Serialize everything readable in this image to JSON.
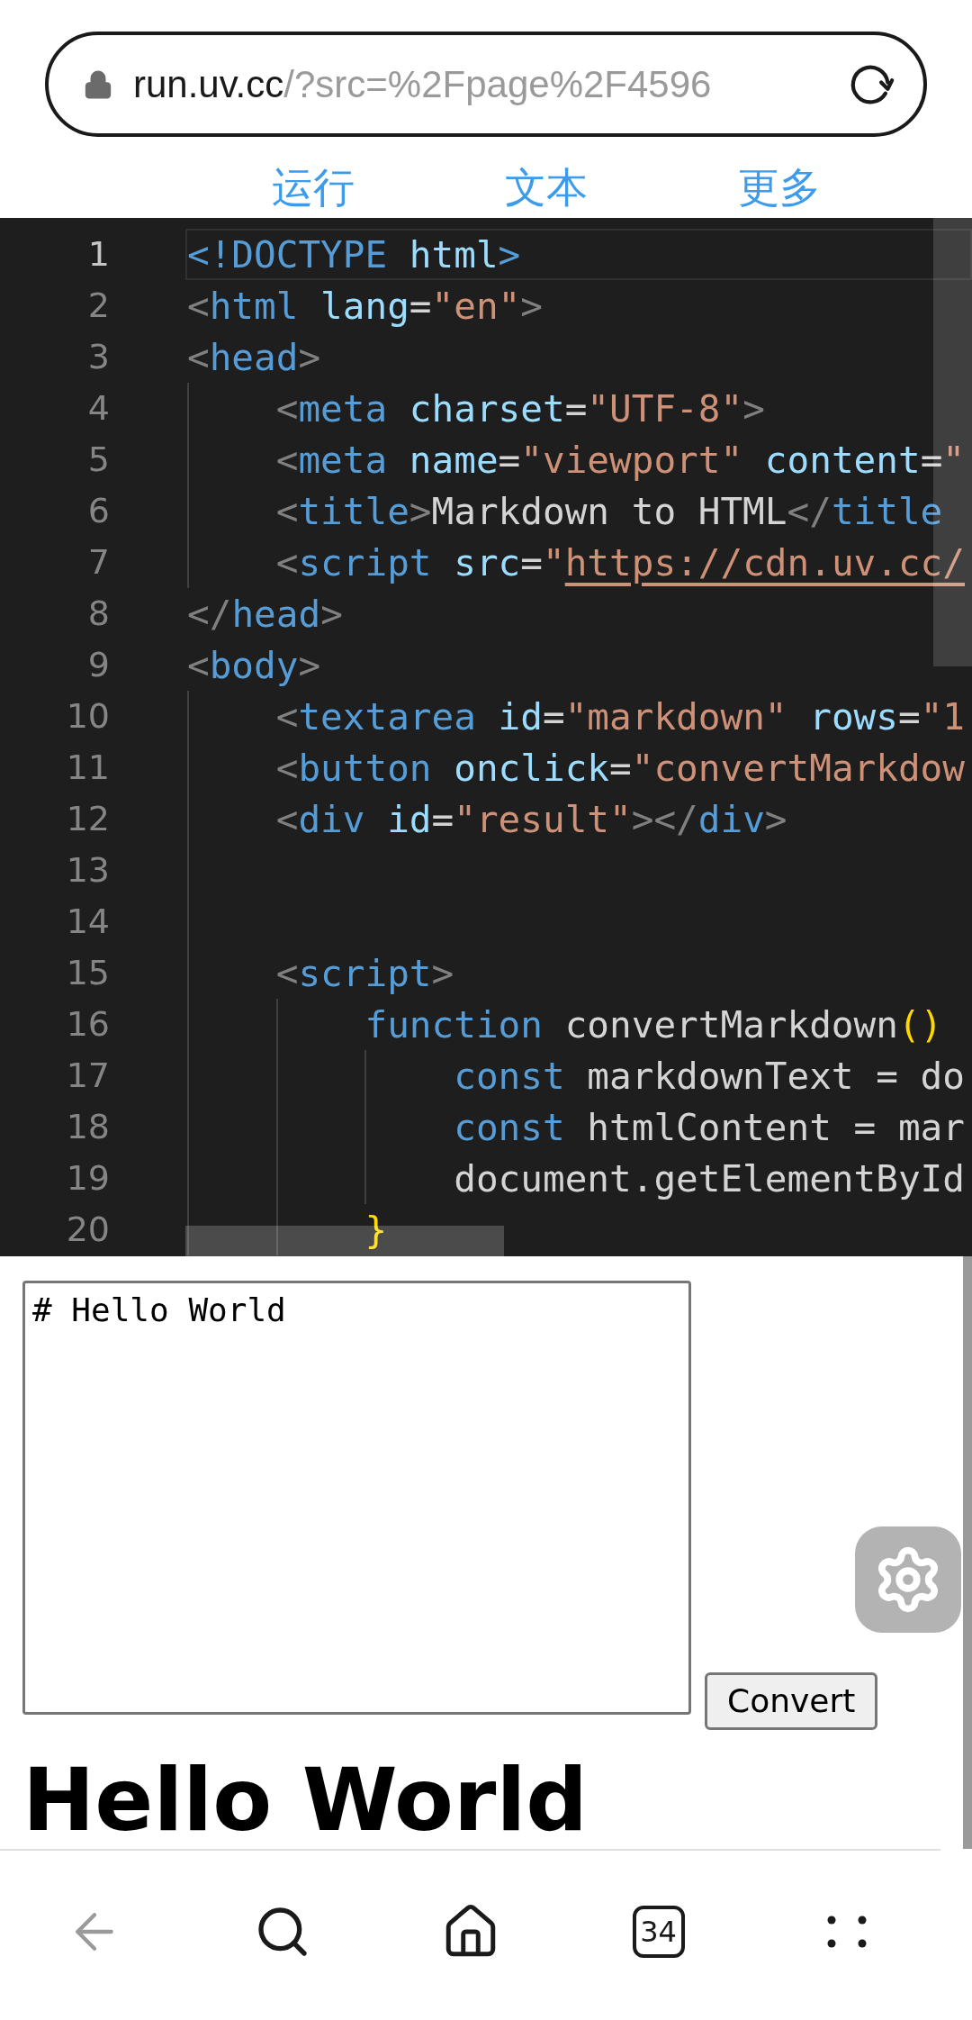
{
  "address_bar": {
    "host": "run.uv.cc",
    "path": "/?src=%2Fpage%2F4596"
  },
  "menu": [
    {
      "label": "运行"
    },
    {
      "label": "文本"
    },
    {
      "label": "更多"
    }
  ],
  "editor": {
    "lines": [
      {
        "number": "1",
        "current": true,
        "tokens": [
          {
            "kind": "tag",
            "text": "<!DOCTYPE"
          },
          {
            "kind": "attr",
            "text": " html"
          },
          {
            "kind": "tag",
            "text": ">"
          }
        ]
      },
      {
        "number": "2",
        "current": false,
        "tokens": [
          {
            "kind": "punct",
            "text": "<"
          },
          {
            "kind": "tag",
            "text": "html"
          },
          {
            "kind": "attr",
            "text": " lang"
          },
          {
            "kind": "text",
            "text": "="
          },
          {
            "kind": "string",
            "text": "\"en\""
          },
          {
            "kind": "punct",
            "text": ">"
          }
        ]
      },
      {
        "number": "3",
        "current": false,
        "tokens": [
          {
            "kind": "punct",
            "text": "<"
          },
          {
            "kind": "tag",
            "text": "head"
          },
          {
            "kind": "punct",
            "text": ">"
          }
        ]
      },
      {
        "number": "4",
        "current": false,
        "tokens": [
          {
            "kind": "punct",
            "text": "    <"
          },
          {
            "kind": "tag",
            "text": "meta"
          },
          {
            "kind": "attr",
            "text": " charset"
          },
          {
            "kind": "text",
            "text": "="
          },
          {
            "kind": "string",
            "text": "\"UTF-8\""
          },
          {
            "kind": "punct",
            "text": ">"
          }
        ]
      },
      {
        "number": "5",
        "current": false,
        "tokens": [
          {
            "kind": "punct",
            "text": "    <"
          },
          {
            "kind": "tag",
            "text": "meta"
          },
          {
            "kind": "attr",
            "text": " name"
          },
          {
            "kind": "text",
            "text": "="
          },
          {
            "kind": "string",
            "text": "\"viewport\""
          },
          {
            "kind": "attr",
            "text": " content"
          },
          {
            "kind": "text",
            "text": "="
          },
          {
            "kind": "string",
            "text": "\""
          }
        ]
      },
      {
        "number": "6",
        "current": false,
        "tokens": [
          {
            "kind": "punct",
            "text": "    <"
          },
          {
            "kind": "tag",
            "text": "title"
          },
          {
            "kind": "punct",
            "text": ">"
          },
          {
            "kind": "text",
            "text": "Markdown to HTML"
          },
          {
            "kind": "punct",
            "text": "</"
          },
          {
            "kind": "tag",
            "text": "title"
          }
        ]
      },
      {
        "number": "7",
        "current": false,
        "tokens": [
          {
            "kind": "punct",
            "text": "    <"
          },
          {
            "kind": "tag",
            "text": "script"
          },
          {
            "kind": "attr",
            "text": " src"
          },
          {
            "kind": "text",
            "text": "="
          },
          {
            "kind": "string",
            "text": "\""
          },
          {
            "kind": "link",
            "text": "https://cdn.uv.cc/"
          }
        ]
      },
      {
        "number": "8",
        "current": false,
        "tokens": [
          {
            "kind": "punct",
            "text": "</"
          },
          {
            "kind": "tag",
            "text": "head"
          },
          {
            "kind": "punct",
            "text": ">"
          }
        ]
      },
      {
        "number": "9",
        "current": false,
        "tokens": [
          {
            "kind": "punct",
            "text": "<"
          },
          {
            "kind": "tag",
            "text": "body"
          },
          {
            "kind": "punct",
            "text": ">"
          }
        ]
      },
      {
        "number": "10",
        "current": false,
        "tokens": [
          {
            "kind": "punct",
            "text": "    <"
          },
          {
            "kind": "tag",
            "text": "textarea"
          },
          {
            "kind": "attr",
            "text": " id"
          },
          {
            "kind": "text",
            "text": "="
          },
          {
            "kind": "string",
            "text": "\"markdown\""
          },
          {
            "kind": "attr",
            "text": " rows"
          },
          {
            "kind": "text",
            "text": "="
          },
          {
            "kind": "string",
            "text": "\"1"
          }
        ]
      },
      {
        "number": "11",
        "current": false,
        "tokens": [
          {
            "kind": "punct",
            "text": "    <"
          },
          {
            "kind": "tag",
            "text": "button"
          },
          {
            "kind": "attr",
            "text": " onclick"
          },
          {
            "kind": "text",
            "text": "="
          },
          {
            "kind": "string",
            "text": "\"convertMarkdow"
          }
        ]
      },
      {
        "number": "12",
        "current": false,
        "tokens": [
          {
            "kind": "punct",
            "text": "    <"
          },
          {
            "kind": "tag",
            "text": "div"
          },
          {
            "kind": "attr",
            "text": " id"
          },
          {
            "kind": "text",
            "text": "="
          },
          {
            "kind": "string",
            "text": "\"result\""
          },
          {
            "kind": "punct",
            "text": "></"
          },
          {
            "kind": "tag",
            "text": "div"
          },
          {
            "kind": "punct",
            "text": ">"
          }
        ]
      },
      {
        "number": "13",
        "current": false
      },
      {
        "number": "14",
        "current": false
      },
      {
        "number": "15",
        "current": false,
        "tokens": [
          {
            "kind": "punct",
            "text": "    <"
          },
          {
            "kind": "tag",
            "text": "script"
          },
          {
            "kind": "punct",
            "text": ">"
          }
        ]
      },
      {
        "number": "16",
        "current": false,
        "tokens": [
          {
            "kind": "keyword",
            "text": "        function"
          },
          {
            "kind": "text",
            "text": " convertMarkdown"
          },
          {
            "kind": "bracket",
            "text": "()"
          }
        ]
      },
      {
        "number": "17",
        "current": false,
        "tokens": [
          {
            "kind": "keyword",
            "text": "            const"
          },
          {
            "kind": "text",
            "text": " markdownText = do"
          }
        ]
      },
      {
        "number": "18",
        "current": false,
        "tokens": [
          {
            "kind": "keyword",
            "text": "            const"
          },
          {
            "kind": "text",
            "text": " htmlContent = mar"
          }
        ]
      },
      {
        "number": "19",
        "current": false,
        "tokens": [
          {
            "kind": "text",
            "text": "            document.getElementById"
          }
        ]
      },
      {
        "number": "20",
        "current": false,
        "tokens": [
          {
            "kind": "bracket",
            "text": "        }"
          }
        ]
      }
    ]
  },
  "preview": {
    "textarea_value": "# Hello World",
    "button": "Convert",
    "heading": "Hello World"
  },
  "bottom_nav": {
    "tab_count": "34"
  }
}
